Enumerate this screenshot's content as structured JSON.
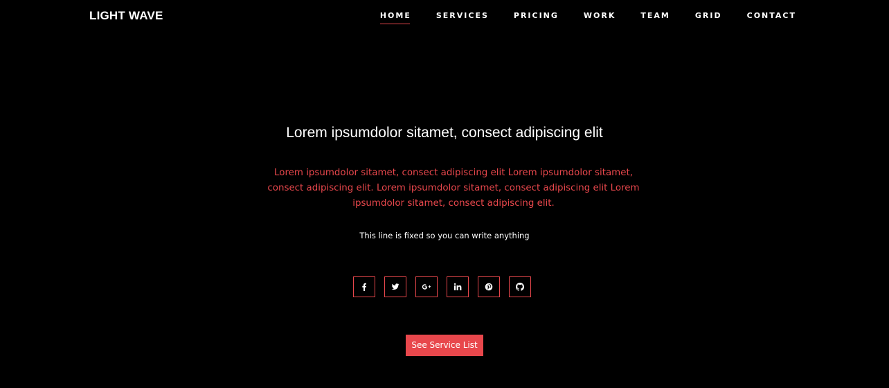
{
  "colors": {
    "background": "#000000",
    "accent": "#e8474c",
    "text": "#ffffff"
  },
  "header": {
    "brand": "LIGHT WAVE",
    "nav": [
      {
        "label": "HOME",
        "active": true
      },
      {
        "label": "SERVICES",
        "active": false
      },
      {
        "label": "PRICING",
        "active": false
      },
      {
        "label": "WORK",
        "active": false
      },
      {
        "label": "TEAM",
        "active": false
      },
      {
        "label": "GRID",
        "active": false
      },
      {
        "label": "CONTACT",
        "active": false
      }
    ]
  },
  "hero": {
    "title": "Lorem ipsumdolor sitamet, consect adipiscing elit",
    "description": "Lorem ipsumdolor sitamet, consect adipiscing elit Lorem ipsumdolor sitamet, consect adipiscing elit. Lorem ipsumdolor sitamet, consect adipiscing elit Lorem ipsumdolor sitamet, consect adipiscing elit.",
    "fixed_line": "This line is fixed so you can write anything",
    "socials": [
      {
        "icon": "facebook-icon"
      },
      {
        "icon": "twitter-icon"
      },
      {
        "icon": "google-plus-icon"
      },
      {
        "icon": "linkedin-icon"
      },
      {
        "icon": "pinterest-icon"
      },
      {
        "icon": "github-icon"
      }
    ],
    "cta_label": "See Service List"
  }
}
